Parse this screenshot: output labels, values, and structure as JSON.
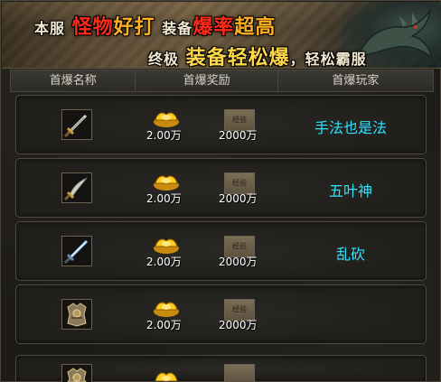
{
  "banner": {
    "line1": [
      {
        "text": "本服",
        "style": "white"
      },
      {
        "text": "怪物",
        "style": "red"
      },
      {
        "text": "好打",
        "style": "orange"
      },
      {
        "text": "装备",
        "style": "white"
      },
      {
        "text": "爆率",
        "style": "red"
      },
      {
        "text": "超高",
        "style": "orange"
      }
    ],
    "line2": [
      {
        "text": "终极",
        "style": "white"
      },
      {
        "text": "装备",
        "style": "yellow"
      },
      {
        "text": "轻松爆",
        "style": "yellow"
      },
      {
        "text": "，轻松霸服",
        "style": "white"
      }
    ]
  },
  "header": {
    "name_col": "首爆名称",
    "reward_col": "首爆奖励",
    "player_col": "首爆玩家"
  },
  "rows": [
    {
      "item_icon": "sword-icon",
      "gold_amount": "2.00万",
      "book_amount": "2000万",
      "book_label": "经验",
      "player": "手法也是法"
    },
    {
      "item_icon": "curved-blade-icon",
      "gold_amount": "2.00万",
      "book_amount": "2000万",
      "book_label": "经验",
      "player": "五叶神"
    },
    {
      "item_icon": "ice-sword-icon",
      "gold_amount": "2.00万",
      "book_amount": "2000万",
      "book_label": "经验",
      "player": "乱砍"
    },
    {
      "item_icon": "armor-icon",
      "gold_amount": "2.00万",
      "book_amount": "2000万",
      "book_label": "经验",
      "player": ""
    },
    {
      "item_icon": "armor-icon",
      "gold_amount": "",
      "book_amount": "",
      "book_label": "",
      "player": ""
    }
  ],
  "colors": {
    "player_name": "#2fe3ff",
    "amount_text": "#ffffff",
    "slogan_red": "#ff2a1a",
    "slogan_orange": "#ffb020",
    "slogan_yellow": "#ffd84a"
  }
}
